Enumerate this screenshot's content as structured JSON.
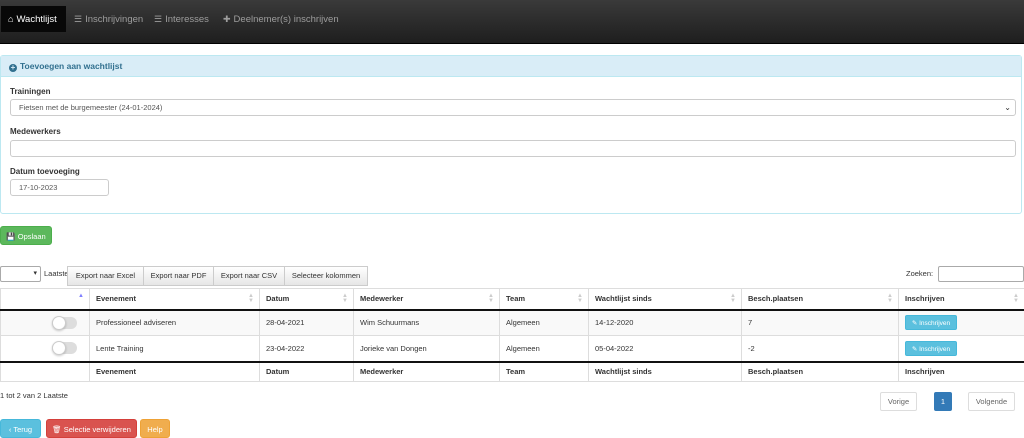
{
  "nav": {
    "items": [
      {
        "label": "Wachtlijst",
        "icon": "home-icon",
        "active": true
      },
      {
        "label": "Inschrijvingen",
        "icon": "list-icon"
      },
      {
        "label": "Interesses",
        "icon": "list-icon"
      },
      {
        "label": "Deelnemer(s) inschrijven",
        "icon": "plus-icon"
      }
    ]
  },
  "form": {
    "heading": "Toevoegen aan wachtlijst",
    "trainingen_label": "Trainingen",
    "trainingen_value": "Fietsen met de burgemeester (24-01-2024)",
    "medewerkers_label": "Medewerkers",
    "medewerkers_value": "",
    "datum_label": "Datum toevoeging",
    "datum_value": "17-10-2023",
    "save_label": "Opslaan"
  },
  "toolbar": {
    "length_label": "Laatste",
    "export_buttons": [
      "Export naar Excel",
      "Export naar PDF",
      "Export naar CSV",
      "Selecteer kolommen"
    ],
    "search_label": "Zoeken:"
  },
  "table": {
    "columns": [
      "",
      "Evenement",
      "Datum",
      "Medewerker",
      "Team",
      "Wachtlijst sinds",
      "Besch.plaatsen",
      "Inschrijven"
    ],
    "rows": [
      {
        "evenement": "Professioneel adviseren",
        "datum": "28-04-2021",
        "medewerker": "Wim Schuurmans",
        "team": "Algemeen",
        "sinds": "14-12-2020",
        "plaatsen": "7",
        "button": "Inschrijven"
      },
      {
        "evenement": "Lente Training",
        "datum": "23-04-2022",
        "medewerker": "Jorieke van Dongen",
        "team": "Algemeen",
        "sinds": "05-04-2022",
        "plaatsen": "-2",
        "button": "Inschrijven"
      }
    ]
  },
  "footer": {
    "info": "1 tot 2 van 2 Laatste",
    "prev": "Vorige",
    "page": "1",
    "next": "Volgende",
    "back": "Terug",
    "delete": "Selectie verwijderen",
    "help": "Help"
  },
  "colors": {
    "success": "#5cb85c",
    "info": "#5bc0de",
    "danger": "#d9534f",
    "warning": "#f0ad4e",
    "primary": "#337ab7"
  }
}
